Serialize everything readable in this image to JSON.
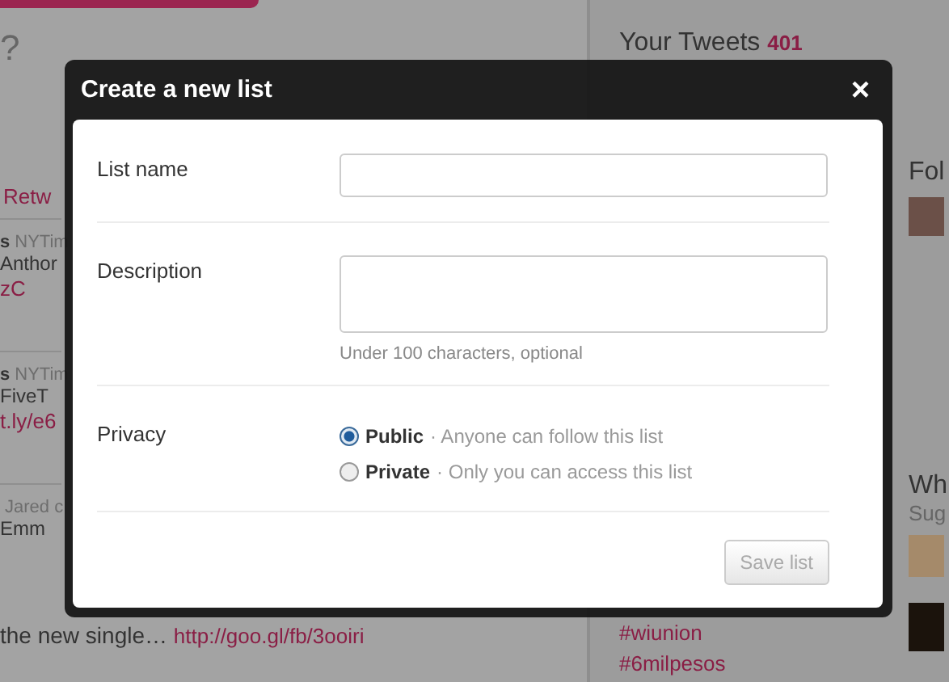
{
  "background": {
    "main": {
      "heading": "?",
      "items": [
        {
          "link": "Retw"
        },
        {
          "user": "s",
          "handle": "NYTim",
          "text": "Anthor",
          "link": "zC"
        },
        {
          "user": "s",
          "handle": "NYTim",
          "text": "FiveT",
          "link": "t.ly/e6"
        },
        {
          "handle": "Jared c",
          "text": "Emm"
        }
      ],
      "footer_text": "the new single…",
      "footer_link": "http://goo.gl/fb/3ooiri"
    },
    "sidebar": {
      "title": "Your Tweets",
      "count": "401",
      "trends": [
        "#wiunion",
        "#6milpesos"
      ],
      "following_title": "Fol",
      "who_title": "Wh",
      "who_subtitle": "Sug"
    }
  },
  "dialog": {
    "title": "Create a new list",
    "close": "×",
    "fields": [
      {
        "kind": "text",
        "label": "List name"
      },
      {
        "kind": "textarea",
        "label": "Description",
        "hint": "Under 100 characters, optional"
      },
      {
        "kind": "radios",
        "label": "Privacy",
        "options": [
          {
            "label": "Public",
            "note": "· Anyone can follow this list",
            "selected": true
          },
          {
            "label": "Private",
            "note": "· Only you can access this list",
            "selected": false
          }
        ]
      }
    ],
    "save": {
      "label": "Save list",
      "disabled": true
    }
  }
}
